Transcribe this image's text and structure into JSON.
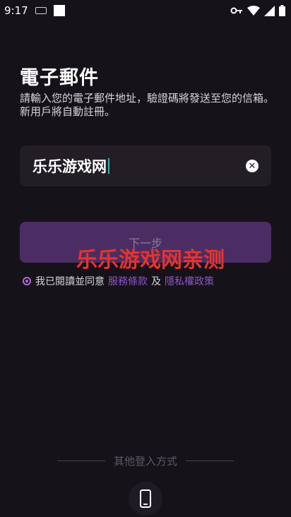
{
  "status_bar": {
    "time": "9:17"
  },
  "page": {
    "title": "電子郵件",
    "description": "請輸入您的電子郵件地址，驗證碼將發送至您的信箱。新用戶將自動註冊。"
  },
  "email_field": {
    "value": "乐乐游戏网"
  },
  "next_button": {
    "label": "下一步"
  },
  "watermark": {
    "text": "乐乐游戏网亲测"
  },
  "agreement": {
    "prefix": "我已閱讀並同意",
    "terms_link": "服務條款",
    "joiner": "及",
    "privacy_link": "隱私權政策"
  },
  "other_login": {
    "label": "其他登入方式"
  },
  "colors": {
    "background": "#161219",
    "accent": "#8e55c9",
    "button_disabled": "#4b2d63",
    "watermark": "#e3342f"
  },
  "icons": [
    "keyboard-icon",
    "vpn-key-icon",
    "wifi-icon",
    "cellular-signal-icon",
    "battery-icon",
    "clear-icon",
    "phone-icon"
  ]
}
